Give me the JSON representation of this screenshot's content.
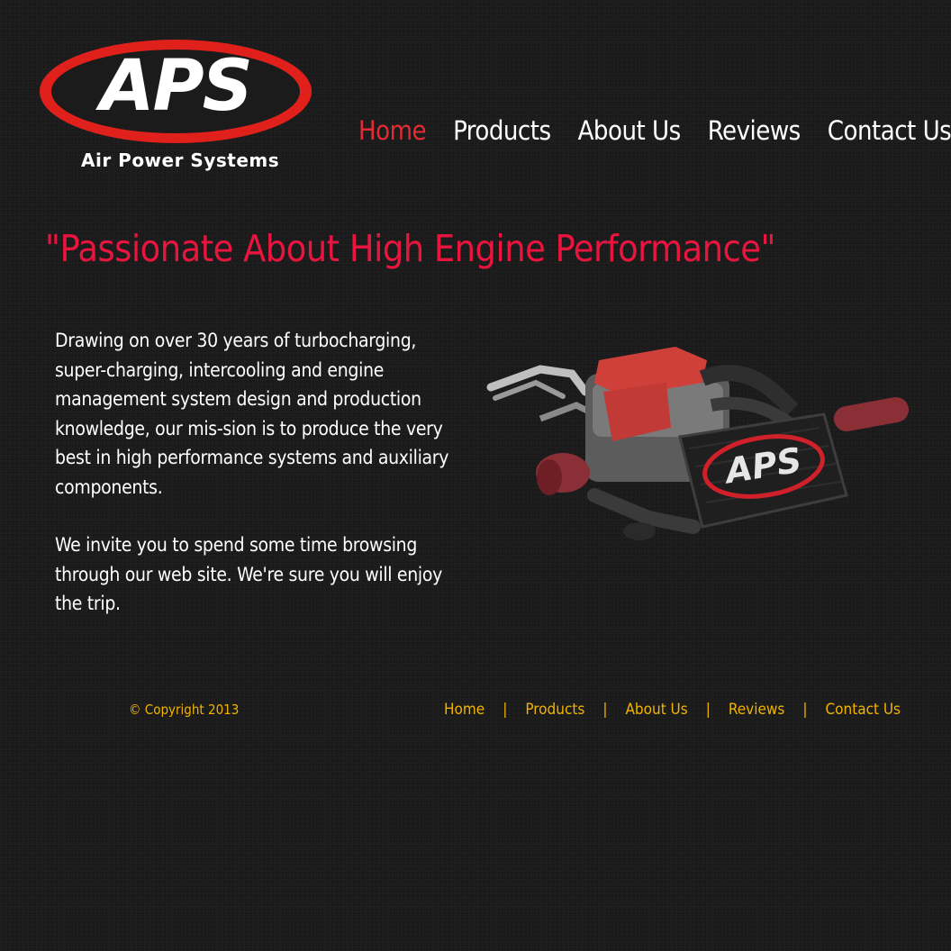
{
  "logo": {
    "letters": "APS",
    "subtitle": "Air Power Systems"
  },
  "nav": {
    "home": "Home",
    "products": "Products",
    "about": "About Us",
    "reviews": "Reviews",
    "contact": "Contact Us"
  },
  "tagline": "\"Passionate About High Engine Performance\"",
  "copy": {
    "p1": "Drawing on over 30 years of turbocharging, super-charging, intercooling and engine management system design and production knowledge, our mis-sion is to produce the very best in high performance systems and auxiliary components.",
    "p2": "We invite you to spend some time browsing through our web site. We're sure you will enjoy the trip."
  },
  "engine": {
    "badge": "APS"
  },
  "footer": {
    "copyright": "© Copyright 2013",
    "home": "Home",
    "products": "Products",
    "about": "About Us",
    "reviews": "Reviews",
    "contact": "Contact Us",
    "separator": "|"
  },
  "colors": {
    "accent_red": "#e9153f",
    "logo_red": "#e0201b",
    "footer_gold": "#f1b300",
    "background": "#1b1b1b"
  }
}
